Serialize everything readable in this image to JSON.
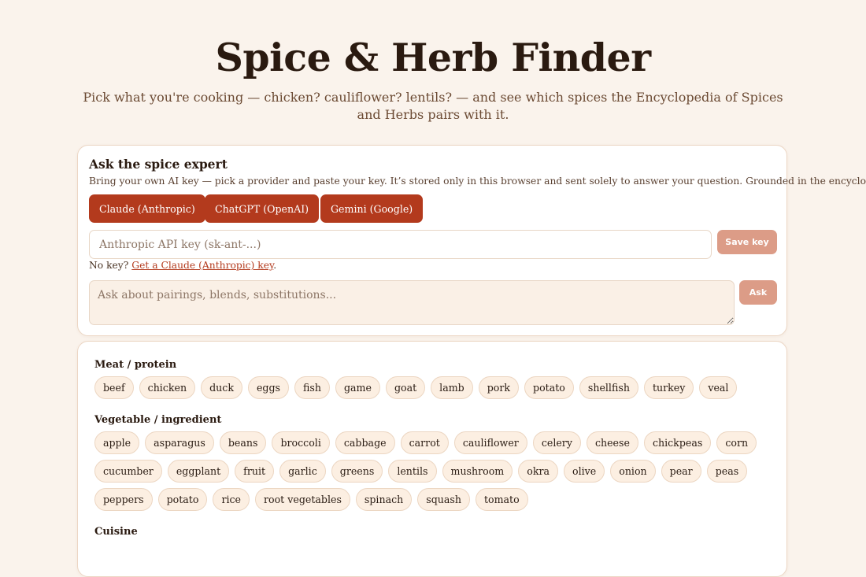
{
  "header": {
    "title": "Spice & Herb Finder",
    "subtitle": "Pick what you're cooking — chicken? cauliflower? lentils? — and see which spices the Encyclopedia of Spices and Herbs pairs with it."
  },
  "ai_panel": {
    "title": "Ask the spice expert",
    "description": "Bring your own AI key — pick a provider and paste your key. It’s stored only in this browser and sent solely to answer your question. Grounded in the encyclopedia.",
    "providers": [
      "Claude (Anthropic)",
      "ChatGPT (OpenAI)",
      "Gemini (Google)"
    ],
    "key_placeholder": "Anthropic API key (sk-ant-...)",
    "save_label": "Save key",
    "no_key_text": "No key?",
    "no_key_link": "Get a Claude (Anthropic) key",
    "ask_placeholder": "Ask about pairings, blends, substitutions...",
    "ask_label": "Ask"
  },
  "categories": [
    {
      "title": "Meat / protein",
      "items": [
        "beef",
        "chicken",
        "duck",
        "eggs",
        "fish",
        "game",
        "goat",
        "lamb",
        "pork",
        "potato",
        "shellfish",
        "turkey",
        "veal"
      ]
    },
    {
      "title": "Vegetable / ingredient",
      "items": [
        "apple",
        "asparagus",
        "beans",
        "broccoli",
        "cabbage",
        "carrot",
        "cauliflower",
        "celery",
        "cheese",
        "chickpeas",
        "corn",
        "cucumber",
        "eggplant",
        "fruit",
        "garlic",
        "greens",
        "lentils",
        "mushroom",
        "okra",
        "olive",
        "onion",
        "pear",
        "peas",
        "peppers",
        "potato",
        "rice",
        "root vegetables",
        "spinach",
        "squash",
        "tomato"
      ]
    },
    {
      "title": "Cuisine",
      "items": []
    }
  ],
  "colors": {
    "background": "#faf3ec",
    "accent": "#b33a1d",
    "muted_button": "#dc9c87",
    "chip": "#fcefe2"
  }
}
